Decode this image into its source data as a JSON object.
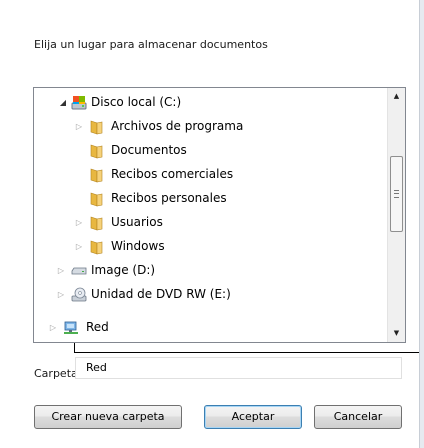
{
  "dialog": {
    "instruction": "Elija un lugar para almacenar documentos",
    "folder_label": "Carpeta:",
    "folder_value": "Red"
  },
  "tree": {
    "items": [
      {
        "label": "Disco local (C:)",
        "icon": "local-disk-icon",
        "expander": "expanded"
      },
      {
        "label": "Archivos de programa",
        "icon": "folder-icon",
        "expander": "collapsed"
      },
      {
        "label": "Documentos",
        "icon": "folder-icon",
        "expander": "none"
      },
      {
        "label": "Recibos comerciales",
        "icon": "folder-icon",
        "expander": "none"
      },
      {
        "label": "Recibos personales",
        "icon": "folder-icon",
        "expander": "none"
      },
      {
        "label": "Usuarios",
        "icon": "folder-icon",
        "expander": "collapsed"
      },
      {
        "label": "Windows",
        "icon": "folder-icon",
        "expander": "collapsed"
      },
      {
        "label": "Image (D:)",
        "icon": "drive-icon",
        "expander": "collapsed"
      },
      {
        "label": "Unidad de DVD RW (E:)",
        "icon": "dvd-drive-icon",
        "expander": "collapsed"
      },
      {
        "label": "Red",
        "icon": "network-icon",
        "expander": "collapsed",
        "selected": true
      }
    ]
  },
  "buttons": {
    "new_folder": "Crear nueva carpeta",
    "ok": "Aceptar",
    "cancel": "Cancelar"
  },
  "colors": {
    "folder": "#e8b740",
    "border": "#828790",
    "default_button": "#3c7fb1"
  }
}
